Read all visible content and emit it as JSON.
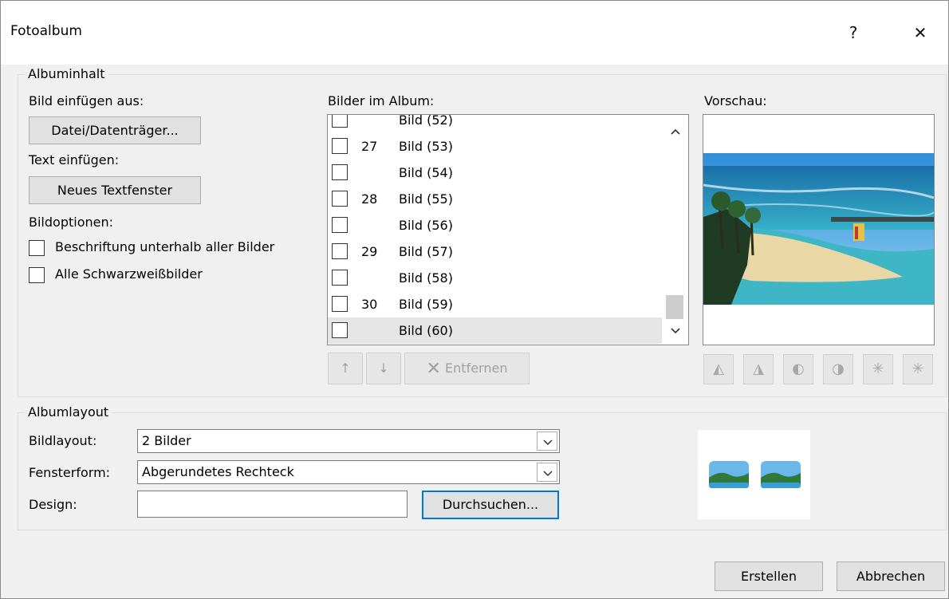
{
  "window": {
    "title": "Fotoalbum",
    "help": "?",
    "close": "✕"
  },
  "content_group": {
    "title": "Albuminhalt",
    "insert_from_label": "Bild einfügen aus:",
    "file_button": "Datei/Datenträger...",
    "insert_text_label": "Text einfügen:",
    "new_textbox_button": "Neues Textfenster",
    "image_options_label": "Bildoptionen:",
    "option_captions": "Beschriftung unterhalb aller Bilder",
    "option_bw": "Alle Schwarzweißbilder",
    "list_label": "Bilder im Album:",
    "list_items": [
      {
        "num": "",
        "label": "Bild (52)"
      },
      {
        "num": "27",
        "label": "Bild (53)"
      },
      {
        "num": "",
        "label": "Bild (54)"
      },
      {
        "num": "28",
        "label": "Bild (55)"
      },
      {
        "num": "",
        "label": "Bild (56)"
      },
      {
        "num": "29",
        "label": "Bild (57)"
      },
      {
        "num": "",
        "label": "Bild (58)"
      },
      {
        "num": "30",
        "label": "Bild (59)"
      },
      {
        "num": "",
        "label": "Bild (60)"
      }
    ],
    "up_icon": "↑",
    "down_icon": "↓",
    "remove_button": "Entfernen",
    "preview_label": "Vorschau:"
  },
  "layout_group": {
    "title": "Albumlayout",
    "picture_layout_label": "Bildlayout:",
    "picture_layout_value": "2 Bilder",
    "frame_shape_label": "Fensterform:",
    "frame_shape_value": "Abgerundetes Rechteck",
    "theme_label": "Design:",
    "theme_value": "",
    "browse_button": "Durchsuchen..."
  },
  "footer": {
    "create_button": "Erstellen",
    "cancel_button": "Abbrechen"
  },
  "colors": {
    "accent": "#0078d7",
    "dialog_bg": "#f0f0f0"
  }
}
